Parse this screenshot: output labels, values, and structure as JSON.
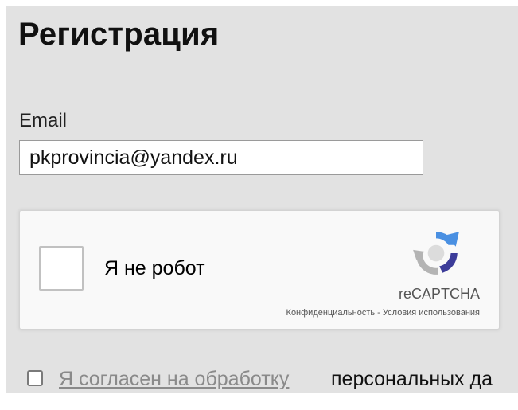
{
  "page": {
    "title": "Регистрация"
  },
  "email": {
    "label": "Email",
    "value": "pkprovincia@yandex.ru"
  },
  "captcha": {
    "checkbox_label": "Я не робот",
    "brand": "reCAPTCHA",
    "privacy_link": "Конфиденциальность",
    "separator": " - ",
    "terms_link": "Условия использования",
    "icon": "recaptcha-logo-icon"
  },
  "consent": {
    "link_text": "Я согласен на обработку",
    "rest_text": " персональных да"
  },
  "colors": {
    "background": "#e2e2e2",
    "recaptcha_blue": "#4a90e2",
    "recaptcha_dark": "#3c3c99",
    "recaptcha_gray": "#b4b4b4"
  }
}
